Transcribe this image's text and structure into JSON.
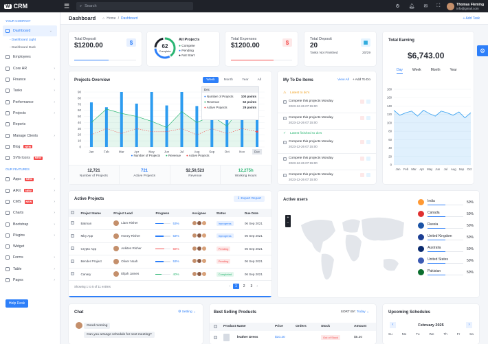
{
  "header": {
    "logo": "CRM",
    "search_placeholder": "Search",
    "user_name": "Thomas Fleming",
    "user_email": "info@gmail.com"
  },
  "page": {
    "title": "Dashboard",
    "crumb_home": "Home",
    "crumb_sep": "/",
    "crumb_current": "Dashboard",
    "add_task": "+ Add Task"
  },
  "sidebar": {
    "section1": "YOUR COMPANY",
    "dashboard": "Dashboard",
    "sub1": "- Dashboard Light",
    "sub2": "- Dashboard Dark",
    "items": [
      "Employees",
      "Core HR",
      "Finance",
      "Tasks",
      "Performance",
      "Projects",
      "Reports",
      "Manage Clients",
      "Blog",
      "SVG Icons"
    ],
    "new_badge": "NEW",
    "section2": "OUR FEATURES",
    "items2": [
      "Apps",
      "AIKit",
      "CMS",
      "Charts",
      "Bootstrap",
      "Plugins",
      "Widget",
      "Forms",
      "Table",
      "Pages"
    ],
    "help": "Help Desk"
  },
  "stats": [
    {
      "label": "Total Deposit",
      "value": "$1200.00",
      "icon": "$",
      "progress": 0.55
    },
    {
      "label": "Total Expenses",
      "value": "$1200.00",
      "icon": "$",
      "progress": 0.7
    },
    {
      "label": "Total Deposit",
      "value": "20",
      "sub": "Tasks Not Finished",
      "count": "20/29"
    }
  ],
  "projects_card": {
    "title": "All Projects",
    "center": "62",
    "center_sub": "Complete",
    "legend": [
      "Compete",
      "Pending",
      "Not Start"
    ]
  },
  "earning": {
    "title": "Total Earning",
    "value": "$6,743.00",
    "tabs": [
      "Day",
      "Week",
      "Month",
      "Year"
    ],
    "y": [
      "180",
      "160",
      "140",
      "120",
      "100",
      "80",
      "60",
      "40",
      "20",
      "0"
    ],
    "x": [
      "Jan",
      "Feb",
      "Mar",
      "Apr",
      "May",
      "Jun",
      "Jul",
      "Aug",
      "Sep",
      "Oct"
    ]
  },
  "overview": {
    "title": "Projects Overview",
    "tabs": [
      "Week",
      "Month",
      "Year",
      "All"
    ],
    "tooltip": {
      "head": "Dec",
      "rows": [
        [
          "Number of Projects",
          "100 points"
        ],
        [
          "Revenue",
          "62 points"
        ],
        [
          "Active Projects",
          "29 points"
        ]
      ]
    },
    "legend": [
      "Number of Projects",
      "Revenue",
      "Active Projects"
    ],
    "summary": [
      [
        "12,721",
        "Number of Projects"
      ],
      [
        "721",
        "Active Projects"
      ],
      [
        "$2,50,523",
        "Revenue"
      ],
      [
        "12,275h",
        "Working Hours"
      ]
    ]
  },
  "chart_data": {
    "type": "bar",
    "categories": [
      "Jan",
      "Feb",
      "Mar",
      "Apr",
      "May",
      "Jun",
      "Jul",
      "Aug",
      "Sep",
      "Oct",
      "Nov",
      "Dec"
    ],
    "ylabel": "",
    "ylim": [
      0,
      90
    ],
    "yticks": [
      "90",
      "80",
      "70",
      "60",
      "50",
      "40",
      "30",
      "20",
      "10",
      "0"
    ],
    "series": [
      {
        "name": "Number of Projects",
        "values": [
          73,
          65,
          90,
          71,
          90,
          68,
          90,
          67,
          90,
          77,
          90,
          85
        ]
      },
      {
        "name": "Revenue",
        "values": [
          40,
          62,
          55,
          50,
          42,
          32,
          58,
          40,
          51,
          34,
          68,
          50
        ]
      },
      {
        "name": "Active Projects",
        "values": [
          20,
          30,
          22,
          30,
          25,
          25,
          30,
          20,
          30,
          22,
          30,
          25
        ]
      }
    ]
  },
  "todo": {
    "title": "My To Do Items",
    "view_all": "View All",
    "add": "+ Add To Do",
    "latest": "Latest to do's",
    "finished": "Latest finished to do's",
    "item_text": "Compete this projects Monday",
    "item_date": "2023-12-26 07:15:00"
  },
  "active_projects": {
    "title": "Active Projects",
    "export": "Export Report",
    "cols": [
      "Project Name",
      "Project Lead",
      "Progress",
      "Assignee",
      "Status",
      "Due Date"
    ],
    "rows": [
      {
        "name": "Batman",
        "lead": "Liam Risher",
        "progress": "53%",
        "status": "Inprogress",
        "due": "06 Sep 2021",
        "pct": 0.53,
        "color": "#2d7ff9"
      },
      {
        "name": "Mby App",
        "lead": "Honey Risher",
        "progress": "53%",
        "status": "Inprogress",
        "due": "06 Sep 2021",
        "pct": 0.53,
        "color": "#2d7ff9"
      },
      {
        "name": "Crypto App",
        "lead": "Ankites Risher",
        "progress": "58%",
        "status": "Pending",
        "due": "06 Sep 2021",
        "pct": 0.58,
        "color": "#f44b4b"
      },
      {
        "name": "Bender Project",
        "lead": "Oliver Noah",
        "progress": "53%",
        "status": "Pending",
        "due": "06 Sep 2021",
        "pct": 0.53,
        "color": "#2d7ff9"
      },
      {
        "name": "Canary",
        "lead": "Elijah James",
        "progress": "40%",
        "status": "Completed",
        "due": "06 Sep 2021",
        "pct": 0.4,
        "color": "#2bb673"
      }
    ],
    "footer": "Showing 1 to 5 of 11 entries",
    "pages": [
      "1",
      "2",
      "3"
    ]
  },
  "active_users": {
    "title": "Active users",
    "countries": [
      [
        "India",
        "50%"
      ],
      [
        "Canada",
        "50%"
      ],
      [
        "Russia",
        "50%"
      ],
      [
        "United Kingdom",
        "50%"
      ],
      [
        "Australia",
        "50%"
      ],
      [
        "United States",
        "50%"
      ],
      [
        "Pakistan",
        "50%"
      ]
    ]
  },
  "chat": {
    "title": "Chat",
    "setting": "Setting",
    "msg1": "Good morning",
    "msg2": "Can you arrange schedule for next meeting?"
  },
  "best": {
    "title": "Best Selling Products",
    "sort_label": "SORT BY:",
    "sort_value": "Today",
    "cols": [
      "Product Name",
      "Price",
      "Orders",
      "Stock",
      "Amount"
    ],
    "row": {
      "name": "leather Dress",
      "price": "$10.20",
      "stock": "Out of Stock",
      "amount": "$5.20"
    }
  },
  "schedule": {
    "title": "Upcoming Schedules",
    "month": "February 2025",
    "days": [
      "Su",
      "Mo",
      "Tu",
      "We",
      "Th",
      "Fr",
      "Sa"
    ]
  }
}
